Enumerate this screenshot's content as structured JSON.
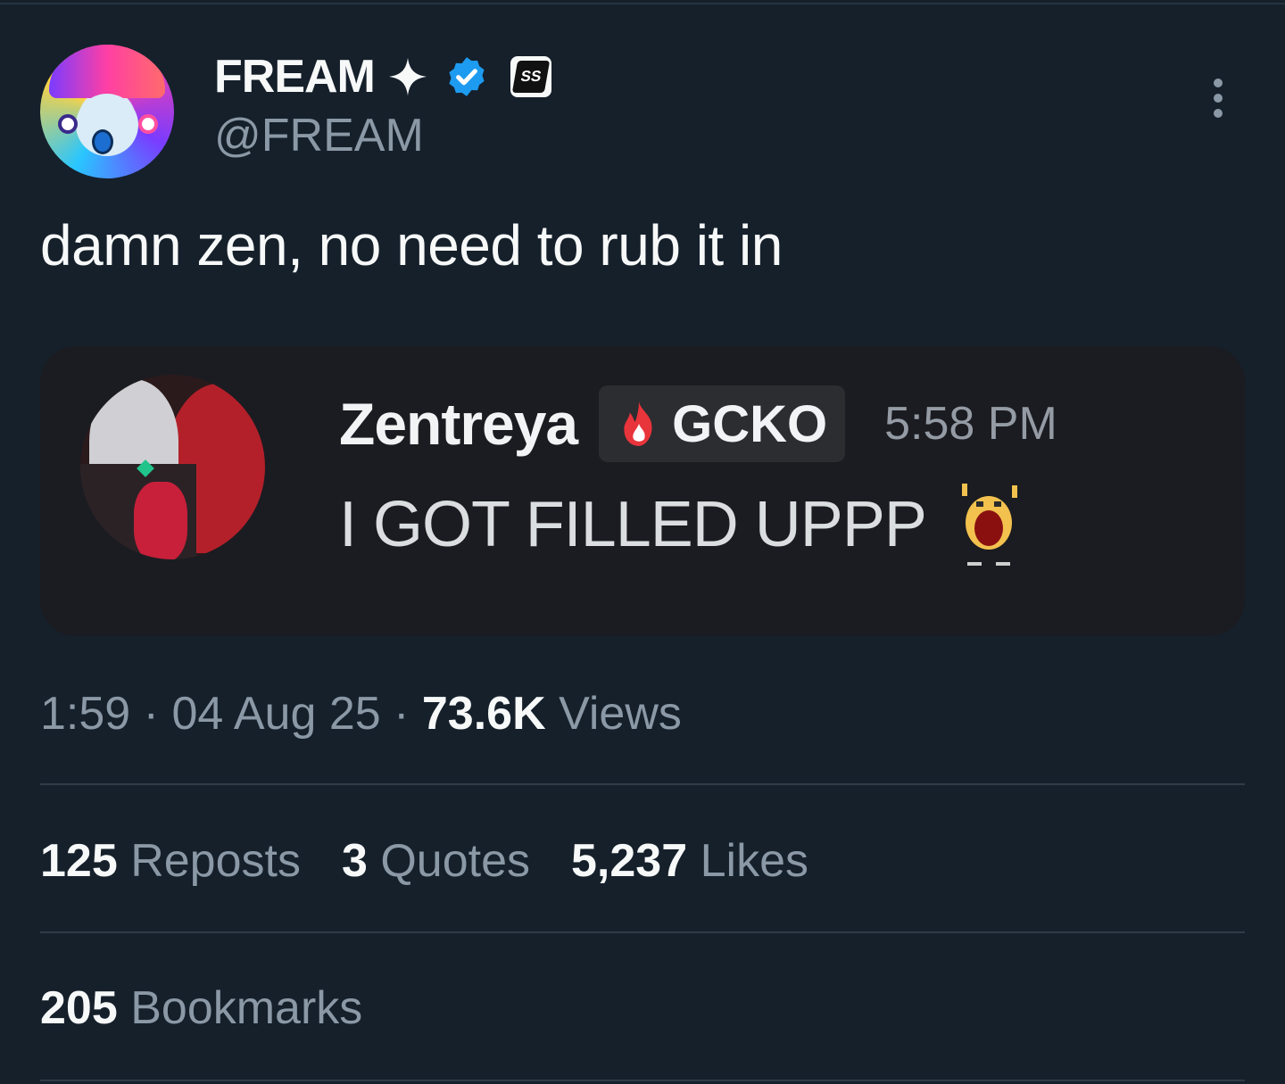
{
  "author": {
    "display_name": "FREAM",
    "handle": "@FREAM",
    "sparkle_icon": "sparkle-icon",
    "verified_icon": "verified-badge-icon",
    "verified_color": "#1d9bf0",
    "affiliate_badge_text": "SS"
  },
  "tweet": {
    "text": "damn zen, no need to rub it in"
  },
  "media": {
    "username": "Zentreya",
    "tag": "GCKO",
    "tag_icon": "fire-icon",
    "time": "5:58 PM",
    "message": "I GOT FILLED UPPP",
    "emoji_icon": "screaming-emoji-icon"
  },
  "meta": {
    "time": "1:59",
    "sep1": " · ",
    "date": "04 Aug 25",
    "sep2": " · ",
    "views_count": "73.6K",
    "views_label": " Views"
  },
  "stats": {
    "reposts_count": "125",
    "reposts_label": " Reposts",
    "quotes_count": "3",
    "quotes_label": " Quotes",
    "likes_count": "5,237",
    "likes_label": " Likes"
  },
  "bookmarks": {
    "count": "205",
    "label": " Bookmarks"
  },
  "colors": {
    "background": "#15202b",
    "secondary_text": "#8b98a5",
    "primary_text": "#f7f9f9"
  }
}
